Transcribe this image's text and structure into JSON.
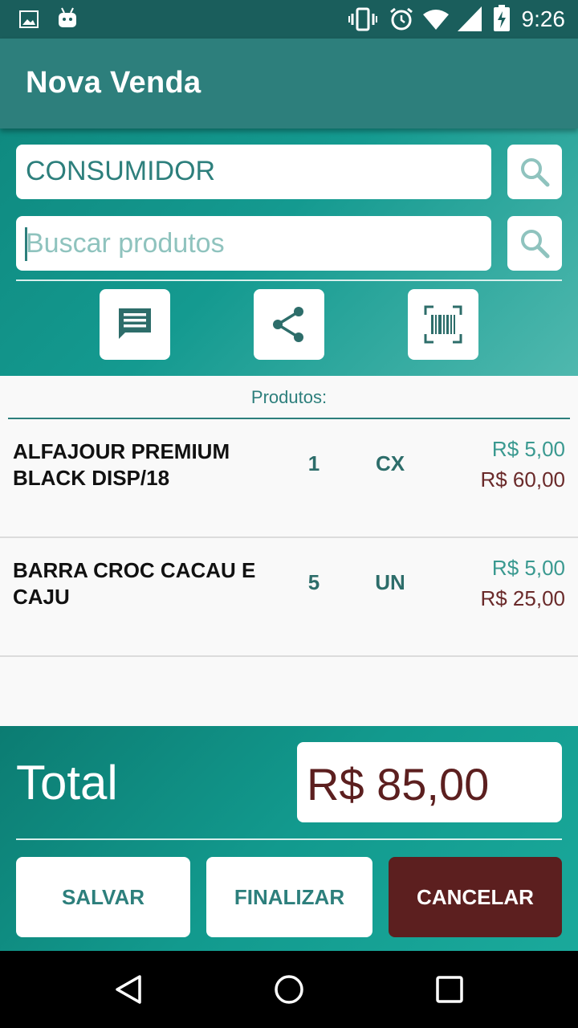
{
  "status_bar": {
    "time": "9:26",
    "icons": [
      "image-icon",
      "android-icon",
      "vibrate-icon",
      "alarm-icon",
      "wifi-icon",
      "signal-icon",
      "battery-charging-icon"
    ]
  },
  "app_bar": {
    "title": "Nova Venda"
  },
  "customer": {
    "value": "CONSUMIDOR"
  },
  "search": {
    "placeholder": "Buscar produtos",
    "value": ""
  },
  "toolbar_icons": [
    "message-icon",
    "share-icon",
    "barcode-scan-icon"
  ],
  "list": {
    "header": "Produtos:",
    "items": [
      {
        "name": "ALFAJOUR PREMIUM BLACK  DISP/18",
        "qty": "1",
        "unit": "CX",
        "unit_price": "R$ 5,00",
        "total": "R$ 60,00"
      },
      {
        "name": "BARRA CROC CACAU E CAJU",
        "qty": "5",
        "unit": "UN",
        "unit_price": "R$ 5,00",
        "total": "R$ 25,00"
      }
    ]
  },
  "total": {
    "label": "Total",
    "value": "R$ 85,00"
  },
  "actions": {
    "save": "SALVAR",
    "finish": "FINALIZAR",
    "cancel": "CANCELAR"
  },
  "colors": {
    "primary": "#2d7f7c",
    "accent_dark_red": "#5c1f1f",
    "teal_gradient_start": "#0f8a80",
    "teal_gradient_end": "#4fb8ae"
  }
}
